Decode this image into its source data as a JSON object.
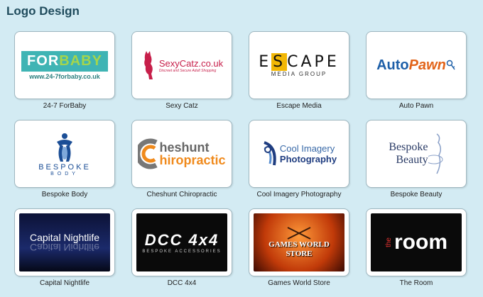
{
  "section": {
    "title": "Logo Design"
  },
  "colors": {
    "background": "#d3ebf3",
    "title": "#1f4b5c",
    "card_border": "#9fb7c0"
  },
  "logos": [
    {
      "caption": "24-7 ForBaby",
      "art": {
        "line1_a": "FOR",
        "line1_b": "BABY",
        "line2": "www.24-7forbaby.co.uk"
      }
    },
    {
      "caption": "Sexy Catz",
      "art": {
        "line1": "SexyCatz.co.uk",
        "line2": "Discreet and Secure Adult Shopping"
      }
    },
    {
      "caption": "Escape Media",
      "art": {
        "line1_a": "E",
        "line1_b": "S",
        "line1_c": "CAPE",
        "line2": "MEDIA GROUP"
      }
    },
    {
      "caption": "Auto Pawn",
      "art": {
        "line1_a": "Auto",
        "line1_b": "Pawn"
      }
    },
    {
      "caption": "Bespoke Body",
      "art": {
        "line1": "BESPOKE",
        "line2": "BODY"
      }
    },
    {
      "caption": "Cheshunt Chiropractic",
      "art": {
        "line1": "heshunt",
        "line2": "hiropractic",
        "initial": "C"
      }
    },
    {
      "caption": "Cool Imagery Photography",
      "art": {
        "line1": "Cool Imagery",
        "line2": "Photography"
      }
    },
    {
      "caption": "Bespoke Beauty",
      "art": {
        "line1": "Bespoke",
        "line2": "Beauty"
      }
    },
    {
      "caption": "Capital Nightlife",
      "art": {
        "line1": "Capital Nightlife"
      }
    },
    {
      "caption": "DCC 4x4",
      "art": {
        "line1": "DCC 4x4",
        "line2": "BESPOKE ACCESSORIES"
      }
    },
    {
      "caption": "Games World Store",
      "art": {
        "line1": "GAMES WORLD",
        "line2": "STORE"
      }
    },
    {
      "caption": "The Room",
      "art": {
        "line1": "room",
        "line2": "the"
      }
    }
  ]
}
